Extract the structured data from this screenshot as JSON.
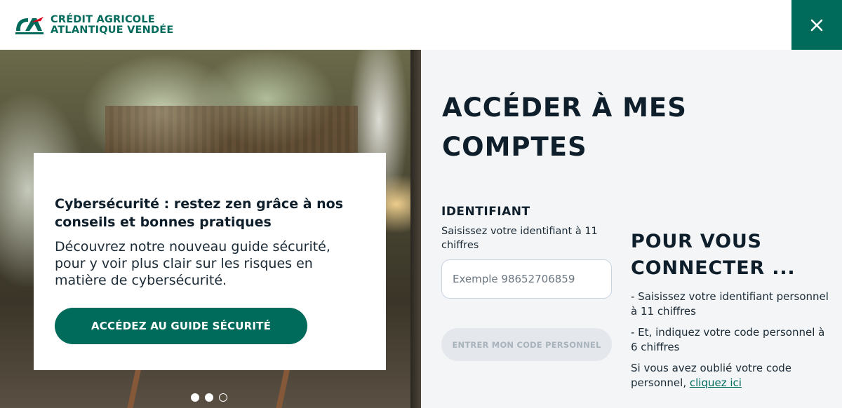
{
  "brand": {
    "line1": "CRÉDIT AGRICOLE",
    "line2": "ATLANTIQUE VENDÉE",
    "color": "#006a5b"
  },
  "close_icon": "close-icon",
  "promo": {
    "title": "Cybersécurité : restez zen grâce à nos conseils et bonnes pratiques",
    "text": "Découvrez notre nouveau guide sécurité, pour y voir plus clair sur les risques en matière de cybersécurité.",
    "button_label": "ACCÉDEZ AU GUIDE SÉCURITÉ",
    "slide_current": 1,
    "slide_count": 3
  },
  "login": {
    "title": "ACCÉDER À MES COMPTES",
    "id_label": "IDENTIFIANT",
    "id_help": "Saisissez votre identifiant à 11 chiffres",
    "id_placeholder": "Exemple 98652706859",
    "enter_button": "ENTRER MON CODE PERSONNEL"
  },
  "help": {
    "title": "POUR VOUS CONNECTER ...",
    "item1": "- Saisissez votre identifiant personnel à 11 chiffres",
    "item2": "- Et, indiquez votre code personnel à 6 chiffres",
    "forgot_text": "Si vous avez oublié votre code personnel, ",
    "forgot_link": "cliquez ici"
  }
}
